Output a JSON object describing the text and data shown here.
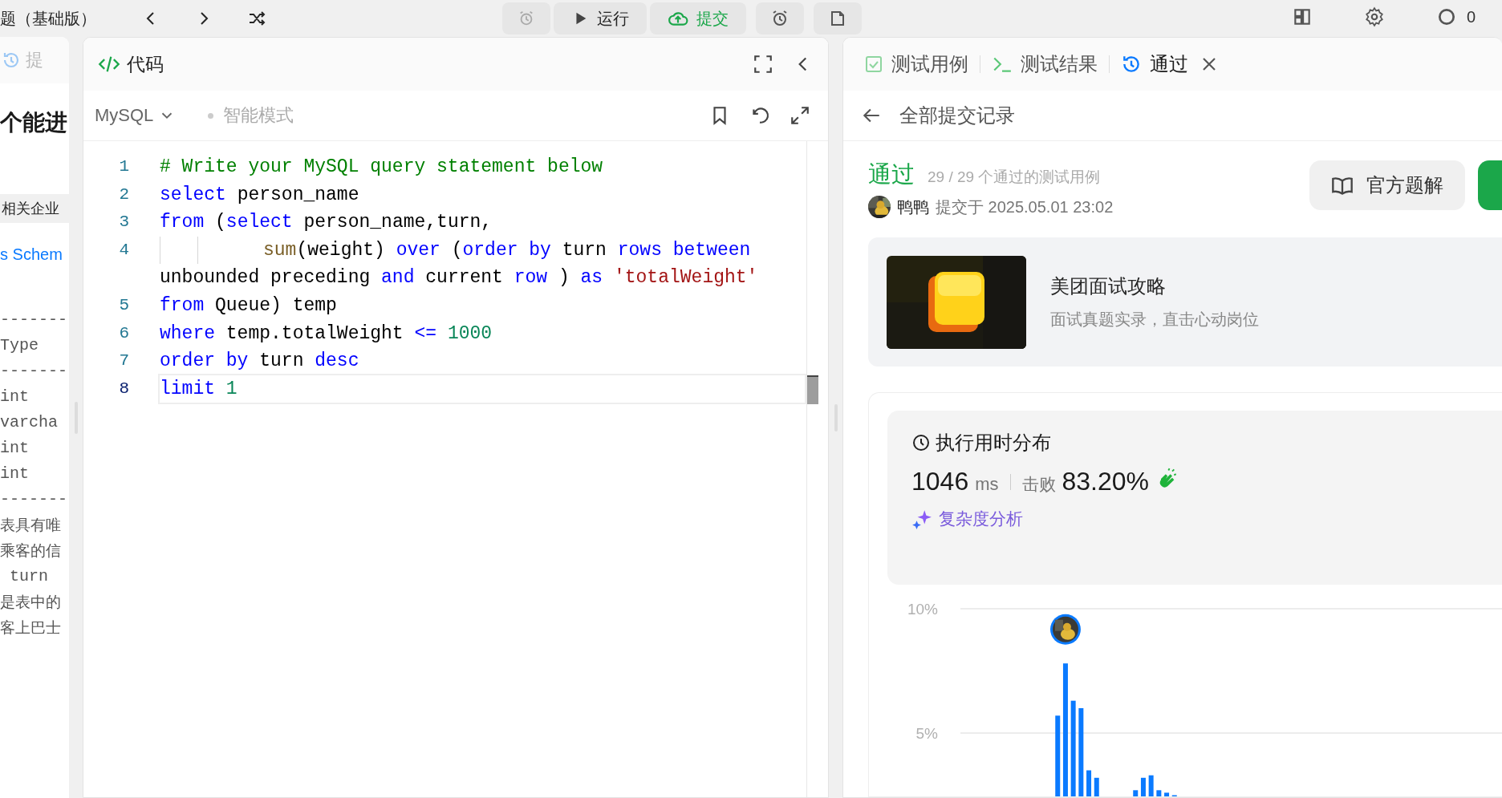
{
  "top_bar": {
    "title": "题（基础版）",
    "run_button": "运行",
    "submit_button": "提交",
    "counter": "0"
  },
  "problem_panel": {
    "tab": "提",
    "title": "个能进",
    "tag": "相关企业",
    "link": "s Schem",
    "schema_lines": [
      {
        "kind": "rule",
        "text": "-------"
      },
      {
        "kind": "code",
        "text": "Type"
      },
      {
        "kind": "rule",
        "text": "-------"
      },
      {
        "kind": "code",
        "text": "int"
      },
      {
        "kind": "code",
        "text": "varcha"
      },
      {
        "kind": "code",
        "text": "int"
      },
      {
        "kind": "code",
        "text": "int"
      },
      {
        "kind": "rule",
        "text": "-------"
      },
      {
        "kind": "prose",
        "text": "表具有唯"
      },
      {
        "kind": "prose",
        "text": "乘客的信"
      },
      {
        "kind": "code",
        "text": " turn"
      },
      {
        "kind": "prose",
        "text": "是表中的"
      },
      {
        "kind": "prose",
        "text": "客上巴士"
      }
    ]
  },
  "code_panel": {
    "title": "代码",
    "language": "MySQL",
    "mode": "智能模式",
    "lines": [
      {
        "number": "1",
        "current": false,
        "indented": false,
        "tokens": [
          {
            "kind": "comment",
            "text": "# Write your MySQL query statement below"
          }
        ]
      },
      {
        "number": "2",
        "current": false,
        "indented": false,
        "tokens": [
          {
            "kind": "keyword",
            "text": "select"
          },
          {
            "kind": "plain",
            "text": " person_name"
          }
        ]
      },
      {
        "number": "3",
        "current": false,
        "indented": false,
        "tokens": [
          {
            "kind": "keyword",
            "text": "from"
          },
          {
            "kind": "plain",
            "text": " ("
          },
          {
            "kind": "keyword",
            "text": "select"
          },
          {
            "kind": "plain",
            "text": " person_name,turn,"
          }
        ]
      },
      {
        "number": "4",
        "current": false,
        "indented": true,
        "tokens": [
          {
            "kind": "function",
            "text": "sum"
          },
          {
            "kind": "plain",
            "text": "(weight) "
          },
          {
            "kind": "keyword",
            "text": "over"
          },
          {
            "kind": "plain",
            "text": " ("
          },
          {
            "kind": "keyword",
            "text": "order by"
          },
          {
            "kind": "plain",
            "text": " turn "
          },
          {
            "kind": "keyword",
            "text": "rows between"
          }
        ]
      },
      {
        "current": false,
        "indented": false,
        "tokens": [
          {
            "kind": "plain",
            "text": "unbounded preceding "
          },
          {
            "kind": "keyword",
            "text": "and"
          },
          {
            "kind": "plain",
            "text": " current "
          },
          {
            "kind": "keyword",
            "text": "row"
          },
          {
            "kind": "plain",
            "text": " ) "
          },
          {
            "kind": "keyword",
            "text": "as"
          },
          {
            "kind": "string",
            "text": " 'totalWeight'"
          }
        ]
      },
      {
        "number": "5",
        "current": false,
        "indented": false,
        "tokens": [
          {
            "kind": "keyword",
            "text": "from"
          },
          {
            "kind": "plain",
            "text": " Queue) temp"
          }
        ]
      },
      {
        "number": "6",
        "current": false,
        "indented": false,
        "tokens": [
          {
            "kind": "keyword",
            "text": "where"
          },
          {
            "kind": "plain",
            "text": " temp.totalWeight "
          },
          {
            "kind": "keyword",
            "text": "<="
          },
          {
            "kind": "number",
            "text": " 1000"
          }
        ]
      },
      {
        "number": "7",
        "current": false,
        "indented": false,
        "tokens": [
          {
            "kind": "keyword",
            "text": "order by"
          },
          {
            "kind": "plain",
            "text": " turn "
          },
          {
            "kind": "keyword",
            "text": "desc"
          }
        ]
      },
      {
        "number": "8",
        "current": true,
        "indented": false,
        "tokens": [
          {
            "kind": "keyword",
            "text": "limit"
          },
          {
            "kind": "number",
            "text": " 1"
          }
        ]
      }
    ]
  },
  "result_panel": {
    "tabs": [
      {
        "kind": "testcase",
        "label": "测试用例",
        "selected": false,
        "closable": false
      },
      {
        "kind": "terminal",
        "label": "测试结果",
        "selected": false,
        "closable": false
      },
      {
        "kind": "history",
        "label": "通过",
        "selected": true,
        "closable": true
      }
    ],
    "back_label": "全部提交记录",
    "status": "通过",
    "cases": "29 / 29 个通过的测试用例",
    "user": "鸭鸭",
    "submitted": "提交于 2025.05.01 23:02",
    "solution_button": "官方题解",
    "promo": {
      "kind": "picture",
      "title": "美团面试攻略",
      "subtitle": "面试真题实录，直击心动岗位"
    },
    "runtime": {
      "heading": "执行用时分布",
      "value": "1046",
      "unit": "ms",
      "beats_label": "击败",
      "beats": "83.20%",
      "analysis_link": "复杂度分析",
      "chart_data": {
        "type": "bar",
        "categories": [
          null,
          null,
          null,
          null,
          null,
          null,
          null,
          null,
          null,
          null,
          null,
          null,
          null,
          null,
          null,
          null,
          null,
          null,
          null,
          null,
          null,
          null,
          null,
          null,
          null,
          null,
          null,
          null,
          null,
          null,
          null,
          null,
          null,
          null,
          null,
          null,
          null,
          null,
          null,
          null,
          null,
          null,
          null,
          null,
          null,
          null,
          null,
          null,
          null,
          null,
          null,
          null,
          null,
          null,
          null,
          null,
          null,
          null,
          null,
          null,
          null,
          null,
          null,
          null,
          null,
          null,
          null,
          null,
          null,
          null
        ],
        "values": [
          null,
          null,
          null,
          null,
          null,
          null,
          null,
          null,
          null,
          null,
          null,
          null,
          5.7,
          7.8,
          6.3,
          6.0,
          3.5,
          3.2,
          null,
          null,
          null,
          null,
          2.7,
          3.2,
          3.3,
          2.7,
          2.6,
          2.5,
          null,
          null,
          null,
          null,
          null,
          null,
          null,
          null,
          null,
          null,
          null,
          null,
          null,
          null,
          null,
          null,
          null,
          null,
          null,
          null,
          null,
          null,
          null,
          null,
          null,
          null,
          null,
          null,
          null,
          null,
          null,
          null,
          null,
          null,
          null,
          null,
          null,
          null,
          null,
          null,
          null,
          null
        ],
        "ylim": [
          0,
          10
        ],
        "yticks": [
          {
            "value": 5,
            "label": "5%"
          },
          {
            "value": 10,
            "label": "10%"
          }
        ]
      }
    }
  }
}
